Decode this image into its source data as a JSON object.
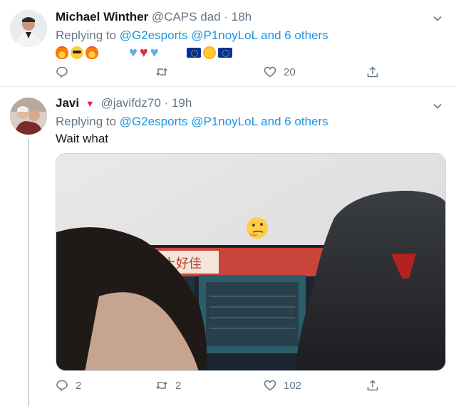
{
  "tweets": [
    {
      "name": "Michael Winther",
      "handle": "@CAPS",
      "handle_suffix": "dad",
      "separator": "·",
      "time": "18h",
      "replying_prefix": "Replying to",
      "mention_1": "@G2esports",
      "mention_2": "@P1noyLoL",
      "replying_suffix": "and 6 others",
      "emojis": [
        "fire",
        "smiling-face-with-sunglasses",
        "fire",
        "blue-heart",
        "red-heart",
        "blue-heart",
        "eu-flag",
        "sun",
        "eu-flag"
      ],
      "reply_count": "",
      "retweet_count": "",
      "like_count": "20"
    },
    {
      "name": "Javi",
      "badge": "▼",
      "handle": "@javifdz70",
      "separator": "·",
      "time": "19h",
      "replying_prefix": "Replying to",
      "mention_1": "@G2esports",
      "mention_2": "@P1noyLoL",
      "replying_suffix": "and 6 others",
      "text": "Wait what",
      "media_alt_icons": [
        "thinking-face"
      ],
      "reply_count": "2",
      "retweet_count": "2",
      "like_count": "102"
    }
  ],
  "colors": {
    "link": "#1b95e0",
    "secondary": "#657786",
    "border": "#e6ecf0",
    "heart_badge": "#e0245e"
  }
}
